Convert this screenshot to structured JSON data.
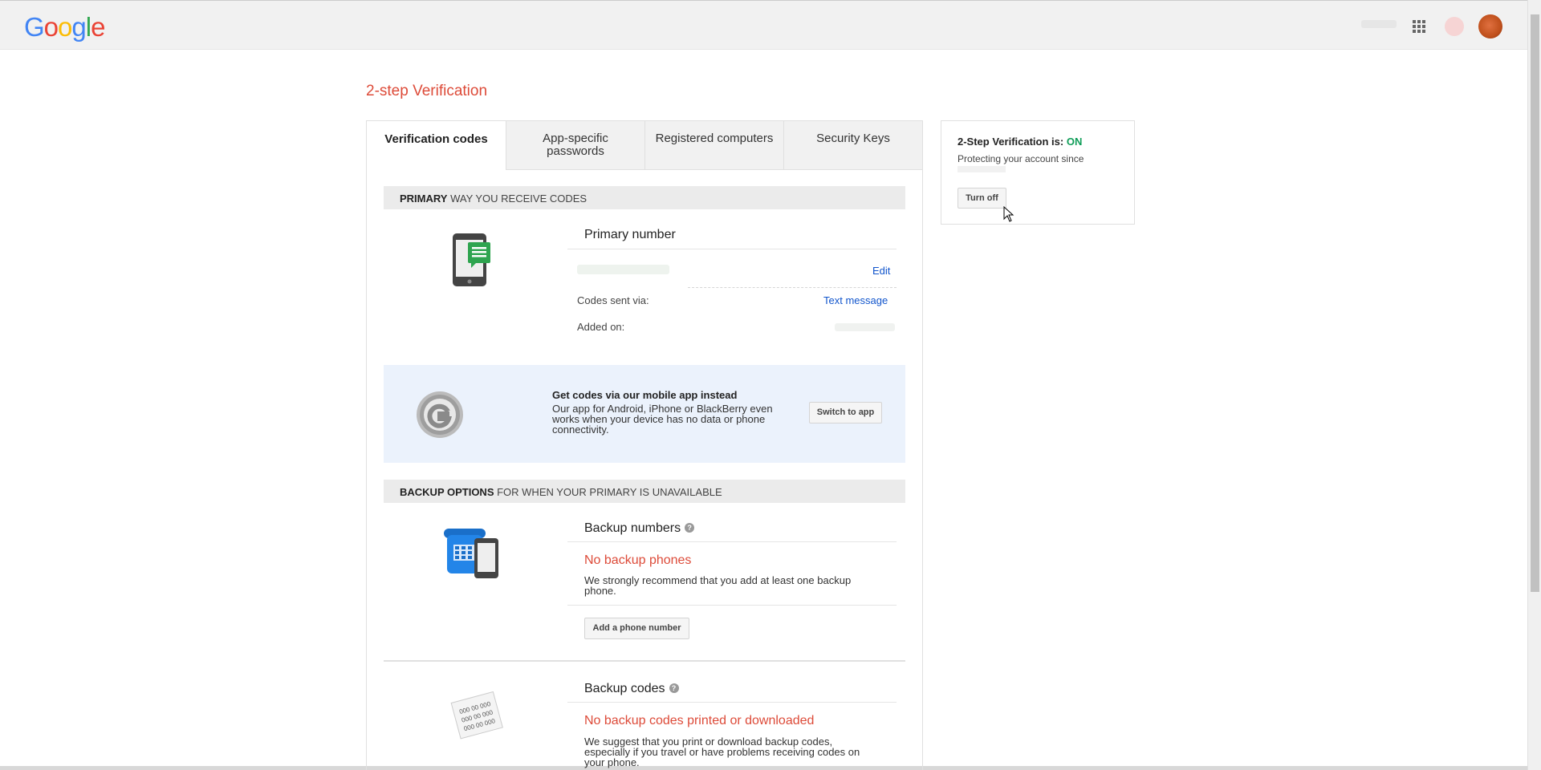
{
  "header": {
    "logo_letters": [
      "G",
      "o",
      "o",
      "g",
      "l",
      "e"
    ],
    "icons": [
      "apps-grid-icon",
      "notifications-icon",
      "avatar"
    ]
  },
  "page": {
    "title": "2-step Verification"
  },
  "tabs": [
    {
      "label": "Verification codes",
      "active": true
    },
    {
      "label": "App-specific passwords",
      "active": false
    },
    {
      "label": "Registered computers",
      "active": false
    },
    {
      "label": "Security Keys",
      "active": false
    }
  ],
  "primary": {
    "section_bold": "PRIMARY",
    "section_rest": " WAY YOU RECEIVE CODES",
    "title": "Primary number",
    "edit_label": "Edit",
    "codes_sent_label": "Codes sent via:",
    "codes_sent_value": "Text message",
    "added_on_label": "Added on:"
  },
  "promo": {
    "title": "Get codes via our mobile app instead",
    "text": "Our app for Android, iPhone or BlackBerry even works when your device has no data or phone connectivity.",
    "button": "Switch to app"
  },
  "backup": {
    "section_bold": "BACKUP OPTIONS",
    "section_rest": " FOR WHEN YOUR PRIMARY IS UNAVAILABLE",
    "numbers_title": "Backup numbers",
    "numbers_empty": "No backup phones",
    "numbers_note": "We strongly recommend that you add at least one backup phone.",
    "add_phone_button": "Add a phone number",
    "codes_title": "Backup codes",
    "codes_empty": "No backup codes printed or downloaded",
    "codes_note": "We suggest that you print or download backup codes, especially if you travel or have problems receiving codes on your phone.",
    "codes_icon_text": "000 00 000"
  },
  "status": {
    "label": "2-Step Verification is: ",
    "value": "ON",
    "since": "Protecting your account since",
    "turn_off_button": "Turn off",
    "on_color": "#0f9d58"
  },
  "colors": {
    "title_red": "#dd4b39",
    "link_blue": "#1155cc",
    "promo_bg": "#ebf2fc"
  }
}
